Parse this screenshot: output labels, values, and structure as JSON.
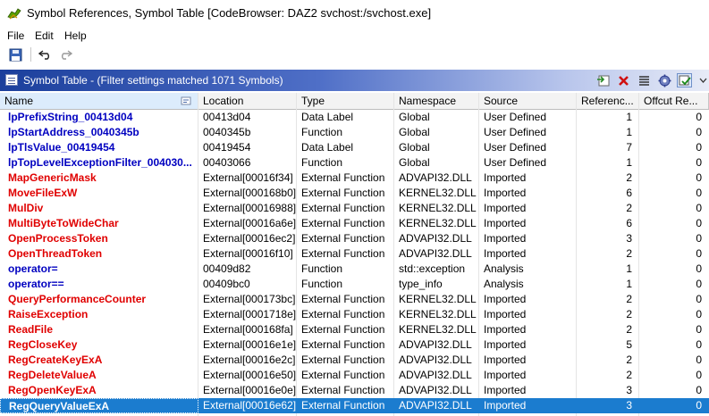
{
  "window": {
    "title": "Symbol References, Symbol Table [CodeBrowser: DAZ2 svchost:/svchost.exe]"
  },
  "menu": [
    "File",
    "Edit",
    "Help"
  ],
  "panel": {
    "title": "Symbol Table - (Filter settings matched 1071 Symbols)"
  },
  "columns": [
    "Name",
    "Location",
    "Type",
    "Namespace",
    "Source",
    "Referenc...",
    "Offcut Re..."
  ],
  "colors": {
    "label_blue": "#0000c0",
    "external_red": "#e00000",
    "selection": "#1b7ccf"
  },
  "rows": [
    {
      "name": "lpPrefixString_00413d04",
      "location": "00413d04",
      "type": "Data Label",
      "namespace": "Global",
      "source": "User Defined",
      "refs": "1",
      "offcut": "0",
      "color": "#0000c0"
    },
    {
      "name": "lpStartAddress_0040345b",
      "location": "0040345b",
      "type": "Function",
      "namespace": "Global",
      "source": "User Defined",
      "refs": "1",
      "offcut": "0",
      "color": "#0000c0"
    },
    {
      "name": "lpTlsValue_00419454",
      "location": "00419454",
      "type": "Data Label",
      "namespace": "Global",
      "source": "User Defined",
      "refs": "7",
      "offcut": "0",
      "color": "#0000c0"
    },
    {
      "name": "lpTopLevelExceptionFilter_004030...",
      "location": "00403066",
      "type": "Function",
      "namespace": "Global",
      "source": "User Defined",
      "refs": "1",
      "offcut": "0",
      "color": "#0000c0"
    },
    {
      "name": "MapGenericMask",
      "location": "External[00016f34]",
      "type": "External Function",
      "namespace": "ADVAPI32.DLL",
      "source": "Imported",
      "refs": "2",
      "offcut": "0",
      "color": "#e00000"
    },
    {
      "name": "MoveFileExW",
      "location": "External[000168b0]",
      "type": "External Function",
      "namespace": "KERNEL32.DLL",
      "source": "Imported",
      "refs": "6",
      "offcut": "0",
      "color": "#e00000"
    },
    {
      "name": "MulDiv",
      "location": "External[00016988]",
      "type": "External Function",
      "namespace": "KERNEL32.DLL",
      "source": "Imported",
      "refs": "2",
      "offcut": "0",
      "color": "#e00000"
    },
    {
      "name": "MultiByteToWideChar",
      "location": "External[00016a6e]",
      "type": "External Function",
      "namespace": "KERNEL32.DLL",
      "source": "Imported",
      "refs": "6",
      "offcut": "0",
      "color": "#e00000"
    },
    {
      "name": "OpenProcessToken",
      "location": "External[00016ec2]",
      "type": "External Function",
      "namespace": "ADVAPI32.DLL",
      "source": "Imported",
      "refs": "3",
      "offcut": "0",
      "color": "#e00000"
    },
    {
      "name": "OpenThreadToken",
      "location": "External[00016f10]",
      "type": "External Function",
      "namespace": "ADVAPI32.DLL",
      "source": "Imported",
      "refs": "2",
      "offcut": "0",
      "color": "#e00000"
    },
    {
      "name": "operator=",
      "location": "00409d82",
      "type": "Function",
      "namespace": "std::exception",
      "source": "Analysis",
      "refs": "1",
      "offcut": "0",
      "color": "#0000c0"
    },
    {
      "name": "operator==",
      "location": "00409bc0",
      "type": "Function",
      "namespace": "type_info",
      "source": "Analysis",
      "refs": "1",
      "offcut": "0",
      "color": "#0000c0"
    },
    {
      "name": "QueryPerformanceCounter",
      "location": "External[000173bc]",
      "type": "External Function",
      "namespace": "KERNEL32.DLL",
      "source": "Imported",
      "refs": "2",
      "offcut": "0",
      "color": "#e00000"
    },
    {
      "name": "RaiseException",
      "location": "External[0001718e]",
      "type": "External Function",
      "namespace": "KERNEL32.DLL",
      "source": "Imported",
      "refs": "2",
      "offcut": "0",
      "color": "#e00000"
    },
    {
      "name": "ReadFile",
      "location": "External[000168fa]",
      "type": "External Function",
      "namespace": "KERNEL32.DLL",
      "source": "Imported",
      "refs": "2",
      "offcut": "0",
      "color": "#e00000"
    },
    {
      "name": "RegCloseKey",
      "location": "External[00016e1e]",
      "type": "External Function",
      "namespace": "ADVAPI32.DLL",
      "source": "Imported",
      "refs": "5",
      "offcut": "0",
      "color": "#e00000"
    },
    {
      "name": "RegCreateKeyExA",
      "location": "External[00016e2c]",
      "type": "External Function",
      "namespace": "ADVAPI32.DLL",
      "source": "Imported",
      "refs": "2",
      "offcut": "0",
      "color": "#e00000"
    },
    {
      "name": "RegDeleteValueA",
      "location": "External[00016e50]",
      "type": "External Function",
      "namespace": "ADVAPI32.DLL",
      "source": "Imported",
      "refs": "2",
      "offcut": "0",
      "color": "#e00000"
    },
    {
      "name": "RegOpenKeyExA",
      "location": "External[00016e0e]",
      "type": "External Function",
      "namespace": "ADVAPI32.DLL",
      "source": "Imported",
      "refs": "3",
      "offcut": "0",
      "color": "#e00000"
    },
    {
      "name": "RegQueryValueExA",
      "location": "External[00016e62]",
      "type": "External Function",
      "namespace": "ADVAPI32.DLL",
      "source": "Imported",
      "refs": "3",
      "offcut": "0",
      "color": "#e00000",
      "selected": true
    }
  ]
}
